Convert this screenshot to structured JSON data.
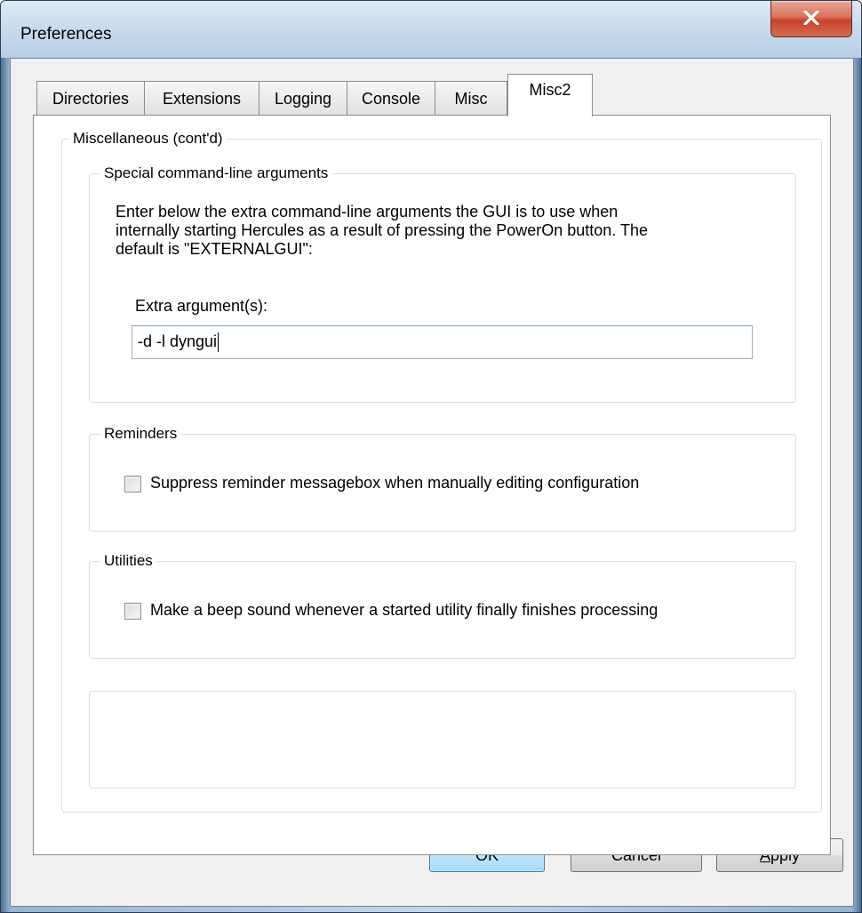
{
  "window": {
    "title": "Preferences"
  },
  "tabs": [
    {
      "label": "Directories"
    },
    {
      "label": "Extensions"
    },
    {
      "label": "Logging"
    },
    {
      "label": "Console"
    },
    {
      "label": "Misc"
    },
    {
      "label": "Misc2",
      "active": true
    }
  ],
  "misc": {
    "group_title": "Miscellaneous (cont'd)",
    "cmdline": {
      "group_title": "Special command-line arguments",
      "description": "Enter below the extra command-line arguments the GUI is to use when\ninternally starting Hercules as a result of pressing the PowerOn button. The\ndefault is \"EXTERNALGUI\":",
      "field_label": "Extra argument(s):",
      "field_value": "-d -l dyngui"
    },
    "reminders": {
      "group_title": "Reminders",
      "checkbox_label": "Suppress reminder messagebox when manually editing configuration",
      "checked": false
    },
    "utilities": {
      "group_title": "Utilities",
      "checkbox_label": "Make a beep sound whenever a started utility finally finishes processing",
      "checked": false
    }
  },
  "buttons": {
    "ok": "OK",
    "cancel": "Cancel",
    "apply_first": "A",
    "apply_rest": "pply"
  }
}
